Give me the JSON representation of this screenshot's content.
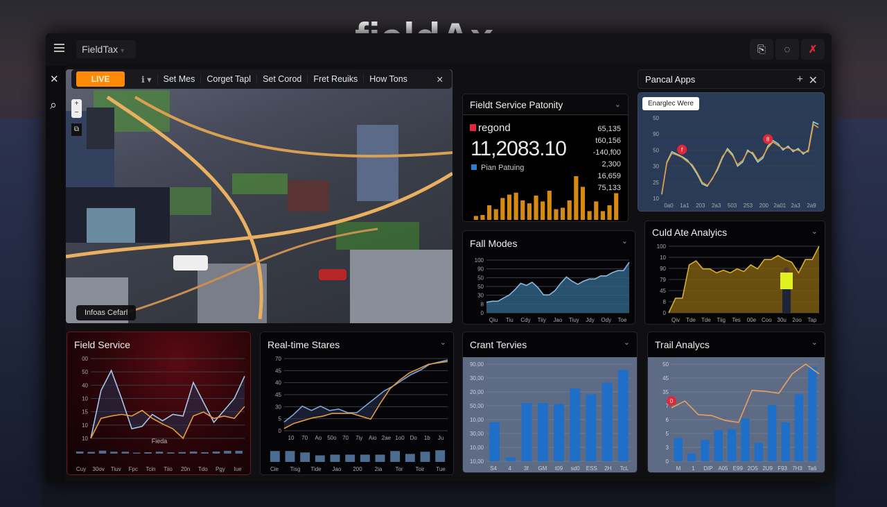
{
  "brand": {
    "logo": "fieldAx"
  },
  "header": {
    "menu_icon": "hamburger-icon",
    "app_selector": "FieldTax",
    "buttons": [
      {
        "icon": "clipboard-icon",
        "glyph": "⎘"
      },
      {
        "icon": "refresh-icon",
        "glyph": "◌"
      },
      {
        "icon": "close-icon",
        "glyph": "✗",
        "color": "#e0283a"
      }
    ]
  },
  "sidebar": {
    "close_glyph": "✕",
    "search_glyph": "⌕"
  },
  "toolbar": {
    "live": "LIVE",
    "dropdown": "ℹ ▾",
    "items": [
      "Set Mes",
      "Corget Tapl",
      "Set Corod",
      "Fret Reuiks",
      "How Tons"
    ],
    "close": "✕"
  },
  "map": {
    "zoom_in": "+",
    "zoom_out": "−",
    "layers": "⧉",
    "caption": "Infoas Cefarl"
  },
  "service_panel": {
    "title": "Fieldt Service Patonity",
    "label": "regond",
    "value": "11,2083.10",
    "legend": "Pian Patuing",
    "list": [
      "65,135",
      "t60,156",
      "-140,f00",
      "2,300",
      "16,659",
      "75,133"
    ],
    "accent": "#e8a020"
  },
  "apps_panel": {
    "title": "Pancal Apps",
    "add": "+",
    "close": "✕",
    "button": "Enarglec Were"
  },
  "colors": {
    "accent": "#ff8a0a",
    "blue": "#2a7fd4",
    "orange": "#e89a3c",
    "line_blue": "#9cc0e8",
    "red": "#e0283a"
  },
  "chart_data": [
    {
      "id": "service_bars",
      "type": "bar",
      "ylim": [
        0,
        100
      ],
      "values": [
        8,
        10,
        30,
        22,
        45,
        52,
        56,
        40,
        34,
        50,
        38,
        60,
        22,
        25,
        40,
        90,
        68,
        18,
        38,
        18,
        30,
        55
      ],
      "color": "#d68a12"
    },
    {
      "id": "apps",
      "type": "line",
      "ylim": [
        0,
        100
      ],
      "ticks": [
        "50",
        "90",
        "50",
        "30",
        "25",
        "10"
      ],
      "xticks": [
        "0a0",
        "1a1",
        "203",
        "2a3",
        "503",
        "253",
        "200",
        "2a01",
        "2a3",
        "2a9"
      ],
      "series": [
        {
          "color": "#8fd8d8",
          "values": [
            5,
            45,
            58,
            55,
            52,
            48,
            40,
            30,
            18,
            15,
            25,
            35,
            50,
            62,
            55,
            40,
            45,
            60,
            55,
            45,
            50,
            65,
            72,
            68,
            60,
            65,
            58,
            62,
            55,
            60,
            95,
            92
          ]
        },
        {
          "color": "#e89a3c",
          "values": [
            6,
            44,
            56,
            54,
            51,
            46,
            42,
            32,
            20,
            16,
            24,
            37,
            52,
            60,
            53,
            42,
            47,
            58,
            57,
            47,
            52,
            63,
            70,
            66,
            62,
            63,
            60,
            60,
            57,
            58,
            92,
            88
          ]
        }
      ],
      "markers": [
        {
          "index": 4,
          "label": "f"
        },
        {
          "index": 21,
          "label": "8"
        }
      ]
    },
    {
      "id": "fall_modes",
      "type": "area",
      "ylim": [
        0,
        100
      ],
      "ticks": [
        "100",
        "90",
        "50",
        "50",
        "30",
        "8",
        "0"
      ],
      "xticks": [
        "Qiu",
        "Tiu",
        "Cdy",
        "Tiiy",
        "Jao",
        "Tiuy",
        "Jdy",
        "Ody",
        "Toe"
      ],
      "series": [
        {
          "color": "#8ab8d8",
          "fill": "#2f5f80",
          "values": [
            20,
            22,
            22,
            28,
            34,
            44,
            56,
            52,
            58,
            48,
            34,
            34,
            42,
            56,
            68,
            60,
            54,
            60,
            64,
            64,
            70,
            70,
            76,
            80,
            80,
            96
          ]
        }
      ]
    },
    {
      "id": "culd_ate",
      "type": "area",
      "ylim": [
        0,
        100
      ],
      "ticks": [
        "100",
        "10",
        "90",
        "79",
        "45",
        "8",
        "0"
      ],
      "xticks": [
        "Qiv",
        "Tde",
        "Tde",
        "Tiig",
        "Tes",
        "00e",
        "Coo",
        "30u",
        "2oo",
        "Tap"
      ],
      "series": [
        {
          "color": "#d8b030",
          "fill": "#7a5c10",
          "values": [
            0,
            22,
            22,
            72,
            78,
            66,
            66,
            60,
            64,
            60,
            66,
            62,
            72,
            66,
            80,
            80,
            86,
            80,
            76,
            60,
            80,
            80,
            100
          ]
        }
      ]
    },
    {
      "id": "field_service",
      "type": "line",
      "ylim": [
        0,
        100
      ],
      "ticks": [
        "00",
        "50",
        "40",
        "10",
        "15",
        "10",
        "10"
      ],
      "xticks": [],
      "fill_between": true,
      "series": [
        {
          "color": "#a9c6ea",
          "values": [
            0,
            60,
            85,
            50,
            12,
            15,
            30,
            22,
            30,
            28,
            70,
            45,
            20,
            35,
            50,
            78
          ]
        },
        {
          "color": "#e89a3c",
          "values": [
            0,
            25,
            28,
            30,
            28,
            35,
            25,
            18,
            12,
            0,
            28,
            33,
            25,
            28,
            25,
            40
          ]
        }
      ]
    },
    {
      "id": "field_service_bars",
      "type": "bar",
      "ylim": [
        0,
        100
      ],
      "label": "Fieda",
      "values": [
        60,
        50,
        85,
        55,
        55,
        28,
        40,
        55,
        35,
        45,
        60,
        40,
        60,
        80,
        80
      ],
      "color": "#4d6d90",
      "xticks": [
        "Cuy",
        "30ov",
        "Tiuv",
        "Fpc",
        "Tcin",
        "Tiio",
        "20n",
        "Tdo",
        "Pgy",
        "Iue"
      ]
    },
    {
      "id": "realtime",
      "type": "line",
      "ylim": [
        0,
        100
      ],
      "ticks": [
        "70",
        "45",
        "40",
        "45",
        "30",
        "5",
        "0"
      ],
      "xticks": [
        "10",
        "70",
        "Ao",
        "50o",
        "70",
        "7iy",
        "Aio",
        "2ae",
        "1o0",
        "Do",
        "1b",
        "Ju"
      ],
      "fill_between": true,
      "series": [
        {
          "color": "#7aa6dc",
          "values": [
            12,
            22,
            34,
            28,
            34,
            28,
            30,
            25,
            25,
            35,
            45,
            55,
            62,
            70,
            78,
            84,
            92,
            95,
            98
          ]
        },
        {
          "color": "#e89a3c",
          "values": [
            3,
            10,
            14,
            18,
            20,
            24,
            24,
            24,
            20,
            16,
            38,
            58,
            70,
            80,
            86,
            92,
            94,
            96
          ]
        }
      ]
    },
    {
      "id": "realtime_bars",
      "type": "bar",
      "ylim": [
        0,
        100
      ],
      "values": [
        75,
        75,
        65,
        45,
        50,
        50,
        50,
        50,
        75,
        55,
        70,
        80
      ],
      "color": "#4d6d90",
      "xticks": [
        "Cie",
        "Tisg",
        "Tide",
        "Jao",
        "200",
        "2ia",
        "Tor",
        "Toir",
        "Tue"
      ]
    },
    {
      "id": "crant",
      "type": "bar",
      "title": "Crant Tervies",
      "ylim": [
        0,
        100
      ],
      "ticks": [
        "90,00",
        "30,00",
        "20,00",
        "50,00",
        "10,00",
        "30,00",
        "10,00",
        "10,00"
      ],
      "xticks": [
        "S4",
        "4",
        "3f",
        "GM",
        "t09",
        "sd0",
        "ESS",
        "2H",
        "TcL"
      ],
      "values": [
        40,
        4,
        60,
        60,
        59,
        75,
        69,
        81,
        94
      ],
      "color": "#1f6fc8"
    },
    {
      "id": "trail",
      "type": "barline",
      "title": "Trail Analycs",
      "ylim": [
        0,
        100
      ],
      "ticks": [
        "50",
        "45",
        "35",
        "7",
        "6",
        "5",
        "3",
        "0"
      ],
      "xticks": [
        "M",
        "1",
        "DIP",
        "A05",
        "E99",
        "2O5",
        "2U9",
        "F93",
        "7H3",
        "Ta6"
      ],
      "values": [
        24,
        8,
        22,
        32,
        33,
        44,
        19,
        58,
        40,
        69,
        97
      ],
      "color": "#1f6fc8",
      "line": {
        "color": "#e8a060",
        "values": [
          55,
          62,
          48,
          47,
          42,
          40,
          73,
          72,
          70,
          90,
          100,
          90
        ]
      },
      "markers": [
        {
          "index": 0,
          "label": "0"
        }
      ]
    }
  ],
  "panels": {
    "fall_modes": "Fall Modes",
    "culd_ate": "Culd Ate Analyics",
    "field_service": "Field Service",
    "realtime": "Real-time Stares",
    "crant": "Crant Tervies",
    "trail": "Trail Analycs"
  }
}
